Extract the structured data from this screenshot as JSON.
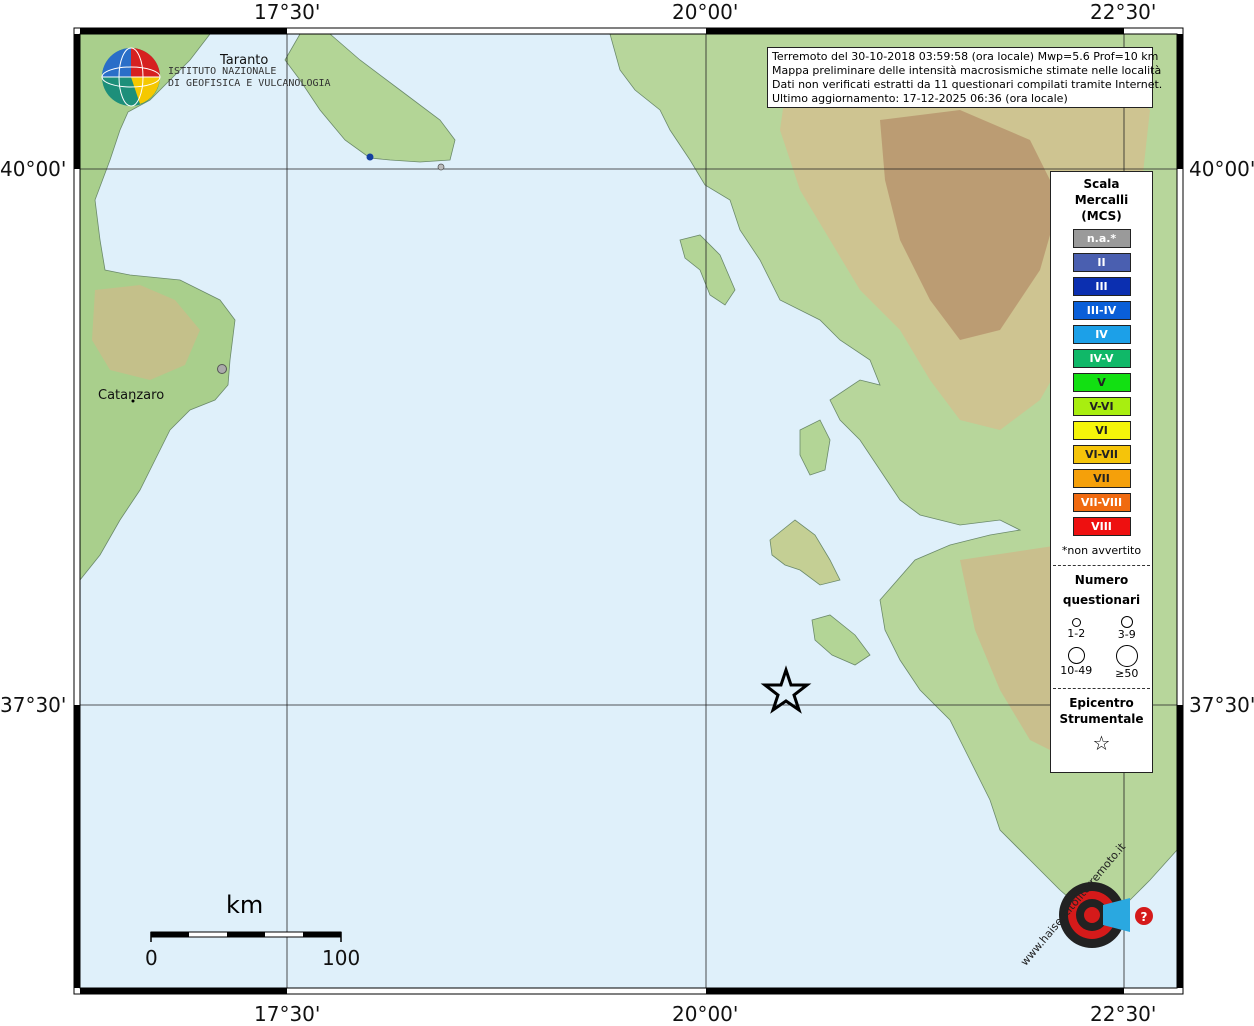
{
  "map": {
    "lon_labels": [
      "17°30'",
      "20°00'",
      "22°30'"
    ],
    "lat_labels": [
      "40°00'",
      "37°30'"
    ],
    "places": [
      "Taranto",
      "Catanzaro"
    ],
    "scale": {
      "unit": "km",
      "start": "0",
      "end": "100"
    }
  },
  "info": {
    "line1": "Terremoto del 30-10-2018 03:59:58 (ora locale) Mwp=5.6 Prof=10 km",
    "line2": "Mappa preliminare delle intensità macrosismiche stimate nelle località",
    "line3": "Dati non verificati estratti da 11 questionari compilati tramite Internet.",
    "line4": "Ultimo aggiornamento: 17-12-2025 06:36 (ora locale)"
  },
  "legend": {
    "title_line1": "Scala",
    "title_line2": "Mercalli",
    "title_line3": "(MCS)",
    "levels": [
      {
        "label": "n.a.*",
        "color": "#9a9a9a"
      },
      {
        "label": "II",
        "color": "#4a5fb0"
      },
      {
        "label": "III",
        "color": "#0b2fb0"
      },
      {
        "label": "III-IV",
        "color": "#0a5fd8"
      },
      {
        "label": "IV",
        "color": "#1ca0e8"
      },
      {
        "label": "IV-V",
        "color": "#10b868"
      },
      {
        "label": "V",
        "color": "#12e012"
      },
      {
        "label": "V-VI",
        "color": "#a8ee10"
      },
      {
        "label": "VI",
        "color": "#f5f50a"
      },
      {
        "label": "VI-VII",
        "color": "#f5c40a"
      },
      {
        "label": "VII",
        "color": "#f5a00a"
      },
      {
        "label": "VII-VIII",
        "color": "#f06a10"
      },
      {
        "label": "VIII",
        "color": "#ee1010"
      }
    ],
    "na_note": "*non avvertito",
    "q_title_line1": "Numero",
    "q_title_line2": "questionari",
    "q_bins": [
      "1-2",
      "3-9",
      "10-49",
      "≥50"
    ],
    "epi_title_line1": "Epicentro",
    "epi_title_line2": "Strumentale",
    "star": "☆"
  },
  "logos": {
    "ingv_line1": "ISTITUTO NAZIONALE",
    "ingv_line2": "DI GEOFISICA E VULCANOLOGIA",
    "hsi_text": "www.haisentitoilterremoto.it"
  },
  "colors": {
    "sea": "#dff0fa",
    "land_low": "#a9d28e",
    "land_mid": "#d9c99a",
    "land_high": "#b98c6a"
  }
}
